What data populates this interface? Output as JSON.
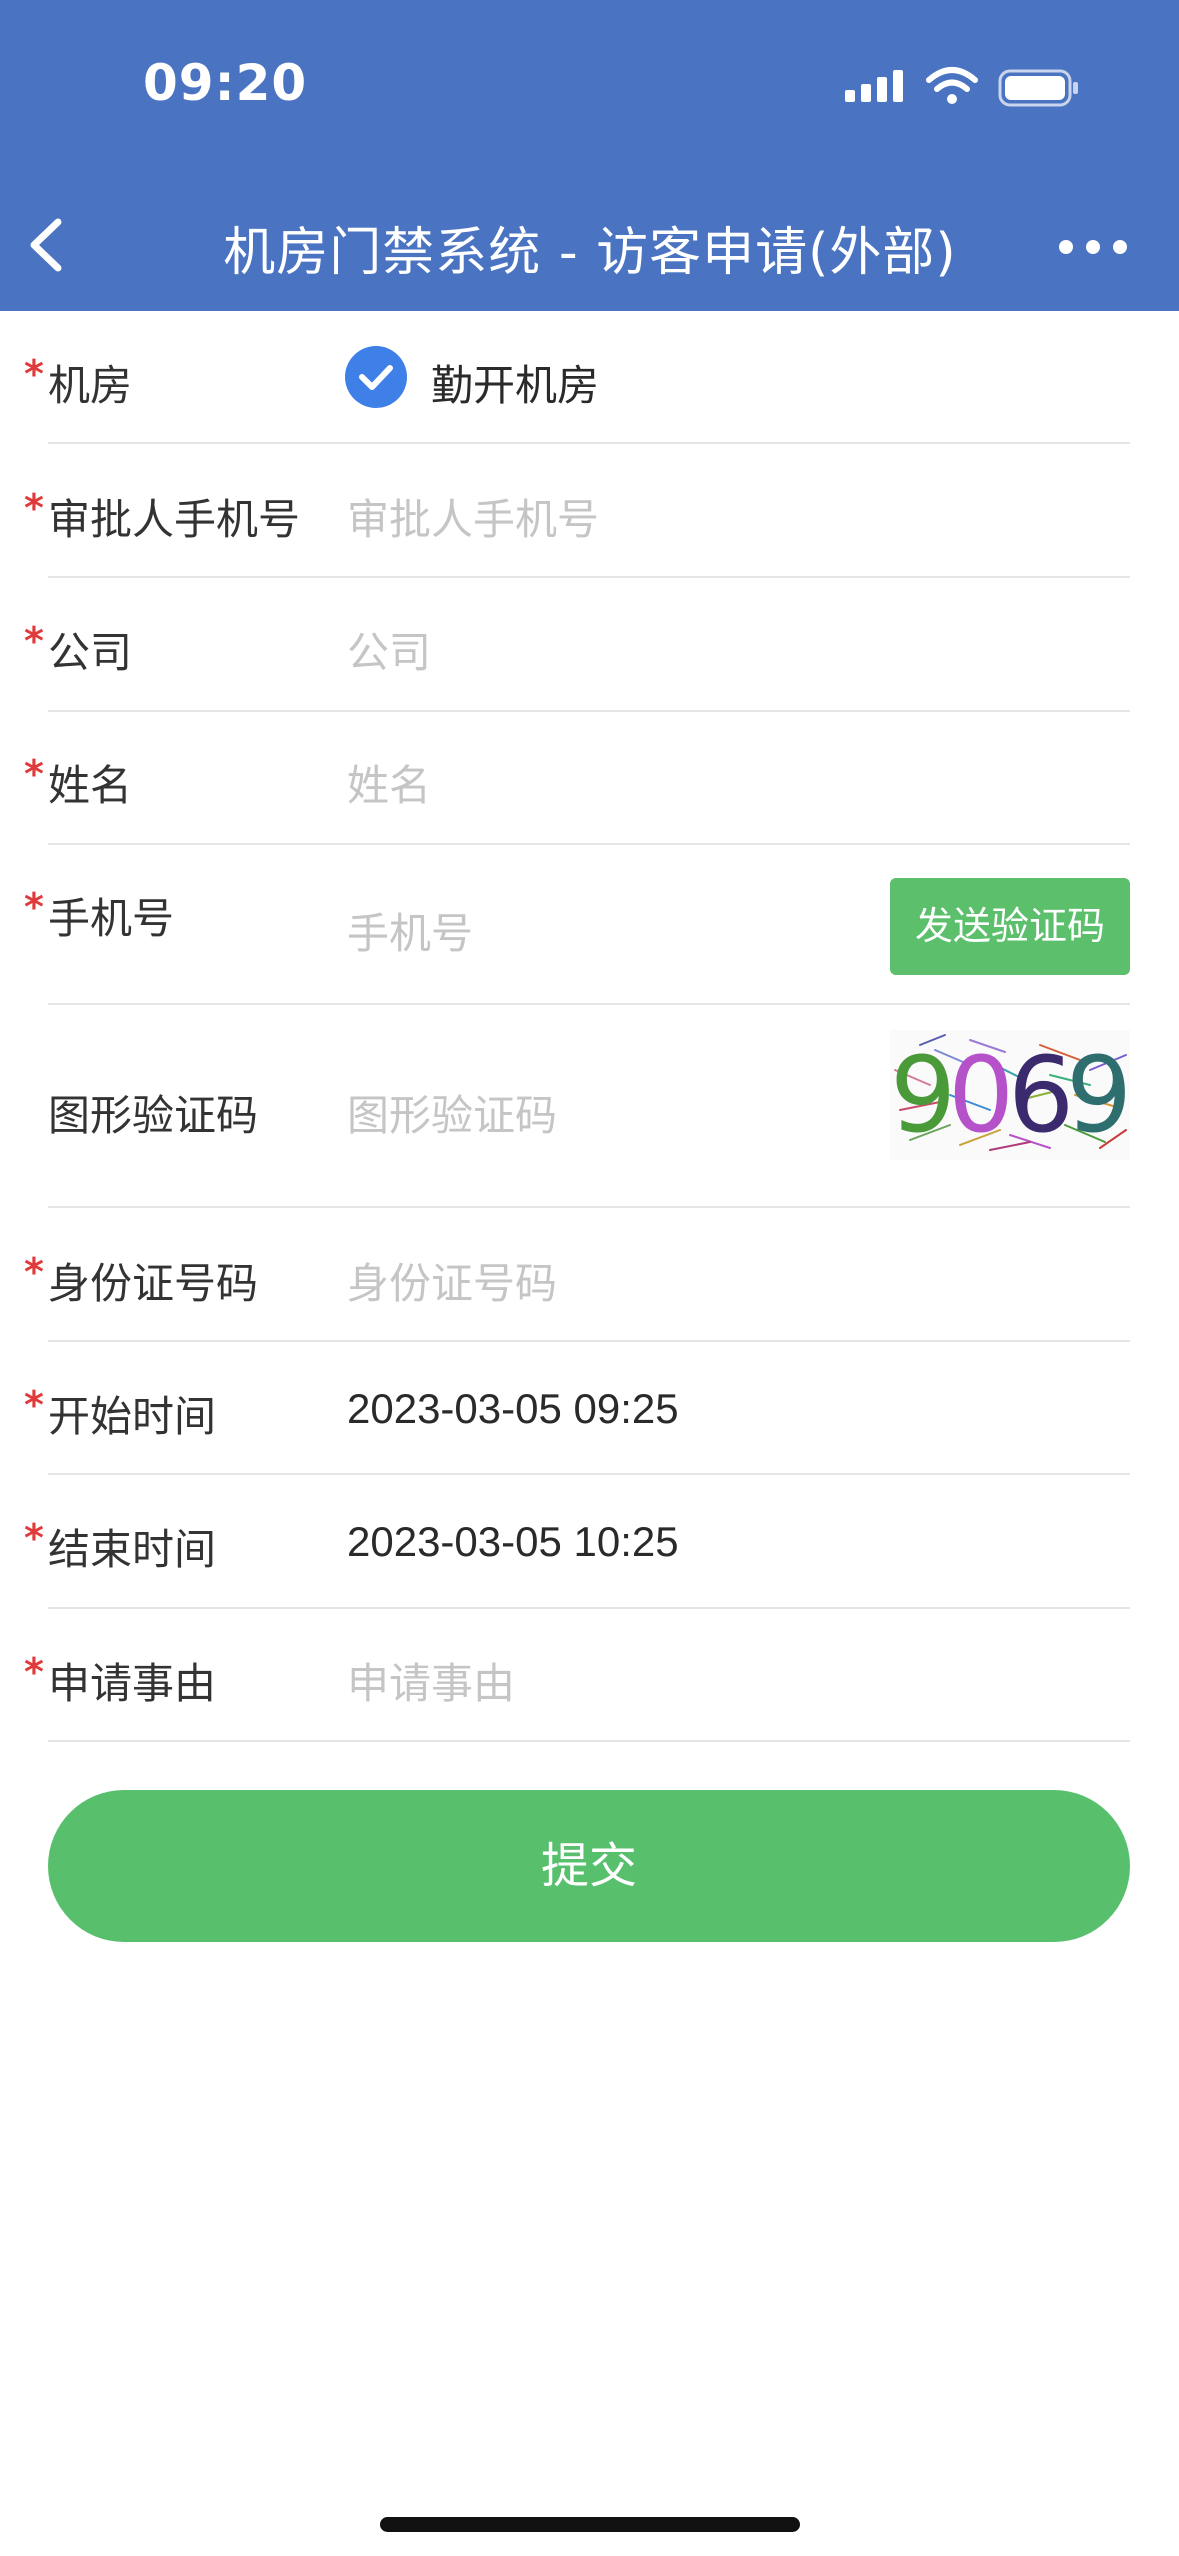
{
  "status_bar": {
    "time": "09:20"
  },
  "nav": {
    "title": "机房门禁系统 - 访客申请(外部)"
  },
  "form": {
    "required_mark": "*",
    "room": {
      "label": "机房",
      "selected": "勤开机房"
    },
    "approver_phone": {
      "label": "审批人手机号",
      "placeholder": "审批人手机号"
    },
    "company": {
      "label": "公司",
      "placeholder": "公司"
    },
    "name": {
      "label": "姓名",
      "placeholder": "姓名"
    },
    "phone": {
      "label": "手机号",
      "placeholder": "手机号",
      "send_code_label": "发送验证码"
    },
    "captcha": {
      "label": "图形验证码",
      "placeholder": "图形验证码",
      "code": [
        "9",
        "0",
        "6",
        "9"
      ],
      "colors": [
        "#4a9a3a",
        "#b552c9",
        "#3b2a6e",
        "#2e6e6e"
      ]
    },
    "id_number": {
      "label": "身份证号码",
      "placeholder": "身份证号码"
    },
    "start_time": {
      "label": "开始时间",
      "value": "2023-03-05 09:25"
    },
    "end_time": {
      "label": "结束时间",
      "value": "2023-03-05 10:25"
    },
    "reason": {
      "label": "申请事由",
      "placeholder": "申请事由"
    },
    "submit_label": "提交"
  },
  "colors": {
    "header": "#4a73c2",
    "primary_green": "#58c06c",
    "checkbox_blue": "#3f7fe8",
    "required_red": "#e03a3a"
  }
}
